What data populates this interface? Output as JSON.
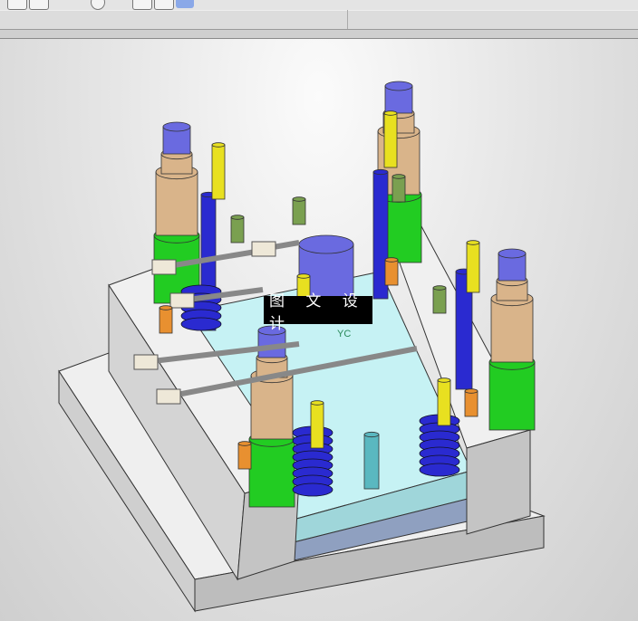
{
  "toolbar": {
    "icons": [
      "line-icon",
      "line-icon",
      "arc-icon",
      "point-icon",
      "circle-icon",
      "fillet-icon",
      "trim-icon",
      "extend-icon",
      "view-icon",
      "render-icon"
    ]
  },
  "viewport": {
    "watermark": "图 文 设 计",
    "axis_label": "YC",
    "colors": {
      "background": "#e6e6e6",
      "plate": "#bfeef0",
      "block": "#e8e8e8",
      "spring": "#2a2ad0",
      "pillar_green": "#22cc22",
      "pillar_tan": "#d9b48a",
      "pillar_top": "#6a6ae0",
      "bolt": "#e8e020"
    }
  }
}
